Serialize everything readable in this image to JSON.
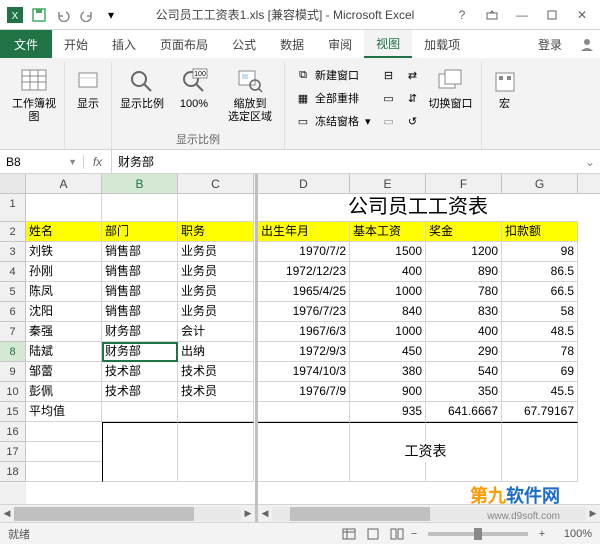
{
  "window": {
    "title": "公司员工工资表1.xls [兼容模式] - Microsoft Excel"
  },
  "tabs": {
    "file": "文件",
    "home": "开始",
    "insert": "插入",
    "layout": "页面布局",
    "formulas": "公式",
    "data": "数据",
    "review": "审阅",
    "view": "视图",
    "addins": "加载项",
    "signin": "登录"
  },
  "ribbon": {
    "workbook_views": "工作簿视图",
    "show": "显示",
    "zoom": "显示比例",
    "zoom100": "100%",
    "zoom_selection": "缩放到\n选定区域",
    "zoom_group": "显示比例",
    "new_window": "新建窗口",
    "arrange_all": "全部重排",
    "freeze_panes": "冻结窗格",
    "switch_windows": "切换窗口",
    "macros": "宏"
  },
  "namebox": "B8",
  "formula_value": "财务部",
  "sheet": {
    "title_merged": "公司员工工资表",
    "headers": {
      "name": "姓名",
      "dept": "部门",
      "job": "职务",
      "birth": "出生年月",
      "base": "基本工资",
      "bonus": "奖金",
      "deduct": "扣款额"
    },
    "rows": [
      {
        "name": "刘铁",
        "dept": "销售部",
        "job": "业务员",
        "birth": "1970/7/2",
        "base": "1500",
        "bonus": "1200",
        "deduct": "98"
      },
      {
        "name": "孙刚",
        "dept": "销售部",
        "job": "业务员",
        "birth": "1972/12/23",
        "base": "400",
        "bonus": "890",
        "deduct": "86.5"
      },
      {
        "name": "陈凤",
        "dept": "销售部",
        "job": "业务员",
        "birth": "1965/4/25",
        "base": "1000",
        "bonus": "780",
        "deduct": "66.5"
      },
      {
        "name": "沈阳",
        "dept": "销售部",
        "job": "业务员",
        "birth": "1976/7/23",
        "base": "840",
        "bonus": "830",
        "deduct": "58"
      },
      {
        "name": "秦强",
        "dept": "财务部",
        "job": "会计",
        "birth": "1967/6/3",
        "base": "1000",
        "bonus": "400",
        "deduct": "48.5"
      },
      {
        "name": "陆斌",
        "dept": "财务部",
        "job": "出纳",
        "birth": "1972/9/3",
        "base": "450",
        "bonus": "290",
        "deduct": "78"
      },
      {
        "name": "邹蕾",
        "dept": "技术部",
        "job": "技术员",
        "birth": "1974/10/3",
        "base": "380",
        "bonus": "540",
        "deduct": "69"
      },
      {
        "name": "彭佩",
        "dept": "技术部",
        "job": "技术员",
        "birth": "1976/7/9",
        "base": "900",
        "bonus": "350",
        "deduct": "45.5"
      }
    ],
    "avg_label": "平均值",
    "avg": {
      "base": "935",
      "bonus": "641.6667",
      "deduct": "67.79167"
    },
    "sub_title": "工资表"
  },
  "statusbar": {
    "ready": "就绪",
    "zoom": "100%"
  },
  "watermark": {
    "brand1": "第九",
    "brand2": "软件网",
    "url": "www.d9soft.com"
  },
  "colors": {
    "accent": "#217346"
  }
}
